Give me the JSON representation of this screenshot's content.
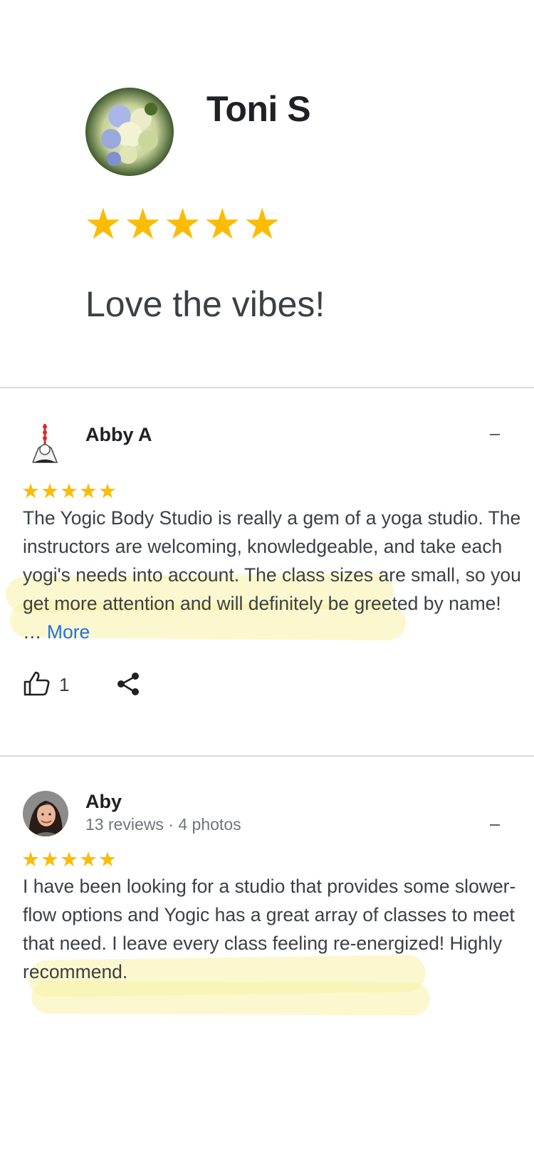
{
  "hero": {
    "name": "Toni S",
    "rating": 5,
    "title": "Love the vibes!"
  },
  "reviews": [
    {
      "name": "Abby A",
      "meta": "",
      "rating": 5,
      "text": "The Yogic Body Studio is really a gem of a yoga studio. The instructors are welcoming, knowledgeable, and take each yogi's needs into account. The class sizes are small, so you get more attention and will definitely be greeted by name! … ",
      "more_label": "More",
      "likes": "1"
    },
    {
      "name": "Aby",
      "meta": "13 reviews · 4 photos",
      "rating": 5,
      "text": "I have been looking for a studio that provides some slower-flow options and Yogic has a great array of classes to meet that need. I leave every class feeling re-energized! Highly recommend."
    }
  ],
  "colors": {
    "star": "#fbbc04",
    "link": "#1a73e8",
    "highlight": "#f8f2a8",
    "divider": "#dadce0"
  },
  "icons": [
    "thumbs-up-icon",
    "share-icon",
    "overflow-menu-icon"
  ]
}
